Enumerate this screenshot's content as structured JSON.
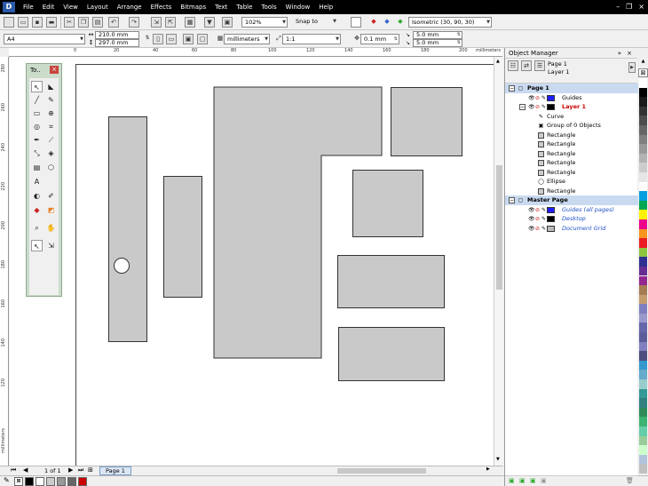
{
  "menu": [
    "File",
    "Edit",
    "View",
    "Layout",
    "Arrange",
    "Effects",
    "Bitmaps",
    "Text",
    "Table",
    "Tools",
    "Window",
    "Help"
  ],
  "standard": {
    "zoom": "102%",
    "snap": "Snap to",
    "view": "Isometric (30, 90, 30)"
  },
  "property": {
    "page_size": "A4",
    "width": "210.0 mm",
    "height": "297.0 mm",
    "units": "millimeters",
    "scale": "1:1",
    "nudge": "0.1 mm",
    "dup_x": "5.0 mm",
    "dup_y": "5.0 mm"
  },
  "ruler": {
    "units": "millimeters",
    "h_ticks": [
      "0",
      "20",
      "40",
      "60",
      "80",
      "100",
      "120",
      "140",
      "160",
      "180",
      "200"
    ],
    "v_ticks": [
      "280",
      "260",
      "240",
      "220",
      "200",
      "180",
      "160",
      "140",
      "120"
    ]
  },
  "toolbox": {
    "title": "To..",
    "close": "×"
  },
  "status": {
    "page_count": "1 of 1",
    "page_tab": "Page 1"
  },
  "object_manager": {
    "title": "Object Manager",
    "current_page": "Page 1",
    "current_layer": "Layer 1",
    "rows": [
      {
        "label": "Page 1",
        "kind": "page"
      },
      {
        "label": "Guides",
        "kind": "layer",
        "color": "#1e1eff"
      },
      {
        "label": "Layer 1",
        "kind": "layer-active",
        "color": "#000000"
      },
      {
        "label": "Curve",
        "kind": "object",
        "icon": "curve"
      },
      {
        "label": "Group of 0 Objects",
        "kind": "object",
        "icon": "group"
      },
      {
        "label": "Rectangle",
        "kind": "object",
        "icon": "rect"
      },
      {
        "label": "Rectangle",
        "kind": "object",
        "icon": "rect"
      },
      {
        "label": "Rectangle",
        "kind": "object",
        "icon": "rect"
      },
      {
        "label": "Rectangle",
        "kind": "object",
        "icon": "rect"
      },
      {
        "label": "Rectangle",
        "kind": "object",
        "icon": "rect"
      },
      {
        "label": "Ellipse",
        "kind": "object",
        "icon": "ellipse"
      },
      {
        "label": "Rectangle",
        "kind": "object",
        "icon": "rect"
      },
      {
        "label": "Master Page",
        "kind": "page"
      },
      {
        "label": "Guides (all pages)",
        "kind": "master",
        "color": "#1e1eff"
      },
      {
        "label": "Desktop",
        "kind": "master",
        "color": "#000000"
      },
      {
        "label": "Document Grid",
        "kind": "master",
        "color": "#bbbbbb"
      }
    ]
  },
  "palette_colors": [
    "#ffffff",
    "#000000",
    "#1a1a1a",
    "#333333",
    "#4d4d4d",
    "#666666",
    "#808080",
    "#999999",
    "#b3b3b3",
    "#cccccc",
    "#e6e6e6",
    "#ffffff",
    "#00a0e0",
    "#00a651",
    "#fff200",
    "#ec008c",
    "#f7941d",
    "#ed1c24",
    "#8dc63f",
    "#2e3192",
    "#662d91",
    "#92278f",
    "#a67c52",
    "#c69c6d",
    "#7f7fbf",
    "#9999cc",
    "#6666aa",
    "#5c5c99",
    "#8080c0",
    "#4d4d80",
    "#3399cc",
    "#66aacc",
    "#99cccc",
    "#339999",
    "#338080",
    "#2e8b57",
    "#3cb371",
    "#66cdaa",
    "#99cc99",
    "#ccffcc",
    "#b0c4de",
    "#c0c0c0"
  ],
  "status_swatches": [
    "#000000",
    "#ffffff",
    "#cccccc",
    "#999999",
    "#666666",
    "#cc0000"
  ]
}
